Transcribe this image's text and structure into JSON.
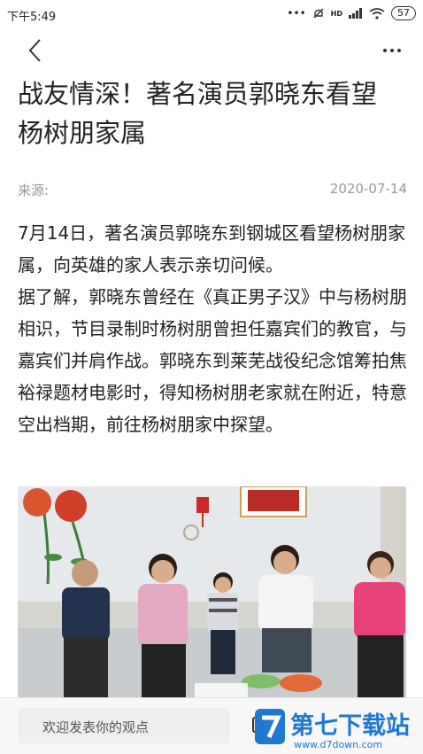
{
  "status_bar": {
    "time": "下午5:49",
    "dots": "•••",
    "network": "HD",
    "battery": "57"
  },
  "article": {
    "title_line1": "战友情深！著名演员郭晓东看望",
    "title_line2": "杨树朋家属",
    "source_label": "来源:",
    "date": "2020-07-14",
    "paragraph1": "7月14日，著名演员郭晓东到钢城区看望杨树朋家属，向英雄的家人表示亲切问候。",
    "paragraph2": "据了解，郭晓东曾经在《真正男子汉》中与杨树朋相识，节目录制时杨树朋曾担任嘉宾们的教官，与嘉宾们并肩作战。郭晓东到莱芜战役纪念馆筹拍焦裕禄题材电影时，得知杨树朋老家就在附近，特意空出档期，前往杨树朋家中探望。"
  },
  "bottom_bar": {
    "comment_placeholder": "欢迎发表你的观点",
    "watermark_text": "第七下载站",
    "watermark_url": "www.d7down.com"
  },
  "colors": {
    "watermark_blue": "#1f78d1",
    "meta_gray": "#999999",
    "text": "#222222"
  }
}
